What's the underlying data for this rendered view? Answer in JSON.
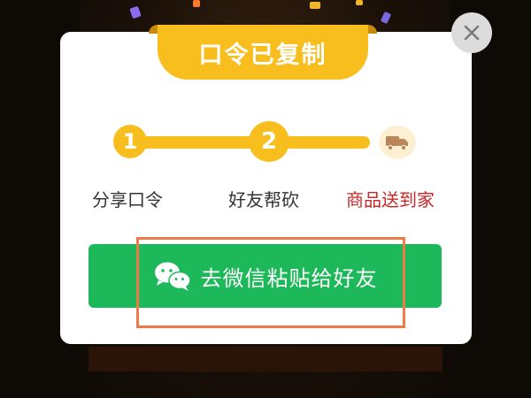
{
  "header": {
    "title": "口令已复制"
  },
  "steps": [
    {
      "number": "1",
      "label": "分享口令"
    },
    {
      "number": "2",
      "label": "好友帮砍"
    },
    {
      "icon": "truck-icon",
      "label": "商品送到家"
    }
  ],
  "action": {
    "label": "去微信粘贴给好友",
    "icon": "wechat-icon"
  },
  "close": {
    "icon": "close-icon"
  },
  "colors": {
    "accent": "#f7be1e",
    "wechat_green": "#1db85a",
    "destination_red": "#c62828",
    "highlight": "#ee7a4a"
  }
}
